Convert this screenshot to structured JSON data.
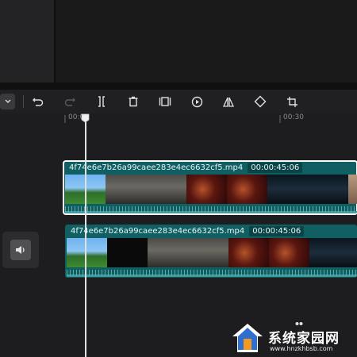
{
  "ruler": {
    "labels": [
      "00:00",
      "00:30"
    ]
  },
  "toolbar": {
    "tools": [
      "undo-icon",
      "redo-icon",
      "split-icon",
      "delete-icon",
      "freeze-frame-icon",
      "play-icon",
      "mirror-icon",
      "rotate-icon",
      "crop-icon"
    ]
  },
  "tracks": [
    {
      "file_name": "4f74e6e7b26a99caee283e4ec6632cf5.mp4",
      "duration": "00:00:45:06",
      "selected": true
    },
    {
      "file_name": "4f74e6e7b26a99caee283e4ec6632cf5.mp4",
      "duration": "00:00:45:06",
      "selected": false
    }
  ],
  "watermark": {
    "title": "系统家园网",
    "url": "www.hnzkhbsb.com"
  },
  "colors": {
    "clip": "#0f5f63",
    "background": "#1d1d1f",
    "selection": "#ffffff"
  }
}
